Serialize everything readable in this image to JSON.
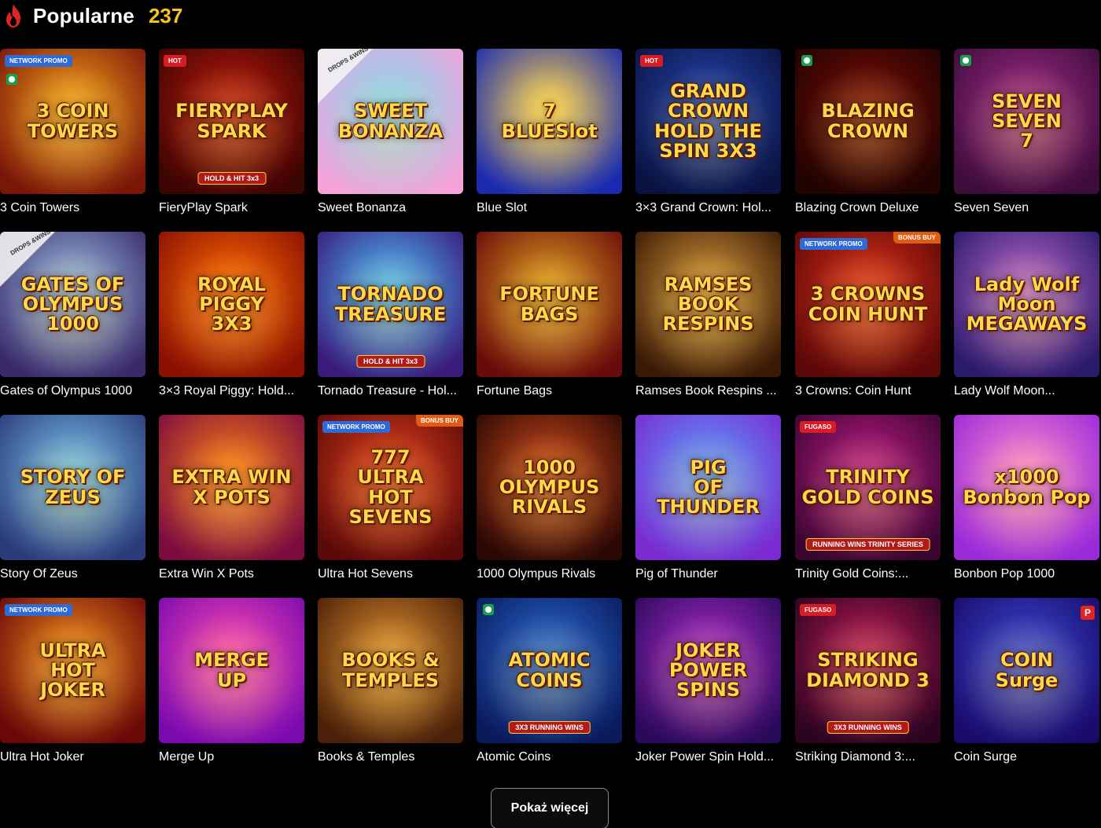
{
  "header": {
    "title": "Popularne",
    "count": "237"
  },
  "games": [
    {
      "label": "3 Coin Towers",
      "art": "3 COIN\nTOWERS",
      "bg": [
        "#f6a21a",
        "#7a1608"
      ],
      "badge": "NETWORK PROMO",
      "badge_type": "promo",
      "icon": true
    },
    {
      "label": "FieryPlay Spark",
      "art": "FIERYPLAY\nSPARK",
      "sub": "HOLD & HIT 3x3",
      "bg": [
        "#c21a0d",
        "#3a0402"
      ],
      "badge": "HOT",
      "badge_type": "hot"
    },
    {
      "label": "Sweet Bonanza",
      "art": "SWEET\nBONANZA",
      "bg": [
        "#7ad8f5",
        "#f5a3d8"
      ],
      "badge": "DROPS &WINS",
      "badge_type": "drops"
    },
    {
      "label": "Blue Slot",
      "art": "7\nBLUESlot",
      "bg": [
        "#ffd54a",
        "#1a2bb0"
      ]
    },
    {
      "label": "3×3 Grand Crown: Hol...",
      "art": "GRAND CROWN\nHOLD THE SPIN 3X3",
      "bg": [
        "#2747b8",
        "#0a1340"
      ],
      "badge": "HOT",
      "badge_type": "hot"
    },
    {
      "label": "Blazing Crown Deluxe",
      "art": "BLAZING\nCROWN",
      "bg": [
        "#7a0c06",
        "#1e0301"
      ],
      "icon": true
    },
    {
      "label": "Seven Seven",
      "art": "SEVEN SEVEN\n7",
      "bg": [
        "#a42b8c",
        "#3c0c3a"
      ],
      "icon": true
    },
    {
      "label": "Gates of Olympus 1000",
      "art": "GATES OF\nOLYMPUS\n1000",
      "bg": [
        "#9dc2e8",
        "#3b2a6a"
      ],
      "badge": "DROPS &WINS",
      "badge_type": "drops"
    },
    {
      "label": "3×3 Royal Piggy: Hold...",
      "art": "ROYAL PIGGY\n3X3",
      "bg": [
        "#ff6a00",
        "#8a1002"
      ]
    },
    {
      "label": "Tornado Treasure - Hol...",
      "art": "TORNADO\nTREASURE",
      "sub": "HOLD & HIT 3x3",
      "bg": [
        "#4fc3ff",
        "#3a1a7a"
      ]
    },
    {
      "label": "Fortune Bags",
      "art": "FORTUNE\nBAGS",
      "bg": [
        "#e0a020",
        "#6a0a0a"
      ]
    },
    {
      "label": "Ramses Book Respins ...",
      "art": "RAMSES\nBOOK\nRESPINS",
      "bg": [
        "#d99a3a",
        "#3a1a06"
      ]
    },
    {
      "label": "3 Crowns: Coin Hunt",
      "art": "3 CROWNS\nCOIN HUNT",
      "bg": [
        "#e0301a",
        "#5a0808"
      ],
      "badge": "NETWORK PROMO",
      "badge_type": "promo",
      "badge2": "BONUS BUY"
    },
    {
      "label": "Lady Wolf Moon...",
      "art": "Lady Wolf Moon\nMEGAWAYS",
      "bg": [
        "#c06ad0",
        "#2a1a6a"
      ]
    },
    {
      "label": "Story Of Zeus",
      "art": "STORY OF ZEUS",
      "bg": [
        "#7ac6f0",
        "#2b3a7a"
      ]
    },
    {
      "label": "Extra Win X Pots",
      "art": "EXTRA WIN\nX POTS",
      "bg": [
        "#ff7a10",
        "#7a0c40"
      ]
    },
    {
      "label": "Ultra Hot Sevens",
      "art": "777\nULTRA\nHOT\nSEVENS",
      "bg": [
        "#e8401a",
        "#5a0a0a"
      ],
      "badge": "NETWORK PROMO",
      "badge_type": "promo",
      "badge2": "BONUS BUY"
    },
    {
      "label": "1000 Olympus Rivals",
      "art": "1000\nOLYMPUS\nRIVALS",
      "bg": [
        "#d04a1a",
        "#2a0804"
      ]
    },
    {
      "label": "Pig of Thunder",
      "art": "PIG\nOF\nTHUNDER",
      "bg": [
        "#5aa0ff",
        "#7a2ad0"
      ]
    },
    {
      "label": "Trinity Gold Coins:...",
      "art": "TRINITY\nGOLD COINS",
      "sub": "RUNNING WINS  TRINITY SERIES",
      "bg": [
        "#c01a8a",
        "#3a0630"
      ],
      "badge": "FUGASO",
      "badge_type": "hot"
    },
    {
      "label": "Bonbon Pop 1000",
      "art": "x1000\nBonbon Pop",
      "bg": [
        "#ff8ad0",
        "#9a2ad8"
      ]
    },
    {
      "label": "Ultra Hot Joker",
      "art": "ULTRA\nHOT\nJOKER",
      "bg": [
        "#f08a1a",
        "#6a0808"
      ],
      "badge": "NETWORK PROMO",
      "badge_type": "promo"
    },
    {
      "label": "Merge Up",
      "art": "MERGE\nUP",
      "bg": [
        "#ff4ab0",
        "#7a0ab0"
      ]
    },
    {
      "label": "Books & Temples",
      "art": "BOOKS &\nTEMPLES",
      "bg": [
        "#e09030",
        "#4a2008"
      ]
    },
    {
      "label": "Atomic Coins",
      "art": "ATOMIC\nCOINS",
      "sub": "3X3 RUNNING WINS",
      "bg": [
        "#2a6ad8",
        "#0a1a5a"
      ],
      "icon": true
    },
    {
      "label": "Joker Power Spin Hold...",
      "art": "JOKER\nPOWER SPINS",
      "bg": [
        "#b02ad0",
        "#2a0a5a"
      ]
    },
    {
      "label": "Striking Diamond 3:...",
      "art": "STRIKING\nDIAMOND 3",
      "sub": "3X3 RUNNING WINS",
      "bg": [
        "#c01a5a",
        "#2a0420"
      ],
      "badge": "FUGASO",
      "badge_type": "hot"
    },
    {
      "label": "Coin Surge",
      "art": "COIN\nSurge",
      "bg": [
        "#3a4ad8",
        "#1a0a6a"
      ],
      "p_icon": "P"
    }
  ],
  "show_more_label": "Pokaż więcej"
}
